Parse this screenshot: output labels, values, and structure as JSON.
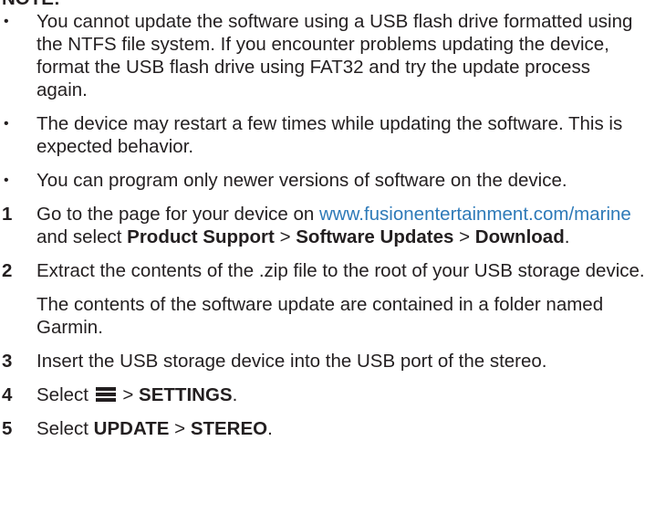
{
  "note": {
    "heading": "NOTE:",
    "bullets": [
      "You cannot update the software using a USB flash drive formatted using the NTFS file system. If you encounter problems updating the device, format the USB flash drive using FAT32 and try the update process again.",
      "The device may restart a few times while updating the software. This is expected behavior.",
      "You can program only newer versions of software on the device."
    ],
    "bullet_glyph": "•"
  },
  "steps": {
    "step1": {
      "number": "1",
      "text_before": "Go to the page for your device on ",
      "link": "www.fusionentertainment.com/marine",
      "text_after_link": " and select ",
      "menu1": "Product Support",
      "sep1": " > ",
      "menu2": "Software Updates",
      "sep2": " > ",
      "menu3": "Download",
      "end": "."
    },
    "step2": {
      "number": "2",
      "text": "Extract the contents of the .zip file to the root of your USB storage device.",
      "subtext": "The contents of the software update are contained in a folder named Garmin."
    },
    "step3": {
      "number": "3",
      "text": "Insert the USB storage device into the USB port of the stereo."
    },
    "step4": {
      "number": "4",
      "text_before": "Select ",
      "icon": "menu-icon",
      "sep": " > ",
      "menu": "SETTINGS",
      "end": "."
    },
    "step5": {
      "number": "5",
      "text_before": "Select ",
      "menu1": "UPDATE",
      "sep": " > ",
      "menu2": "STEREO",
      "end": "."
    }
  },
  "colors": {
    "text": "#231f20",
    "link": "#2e7ab8"
  }
}
